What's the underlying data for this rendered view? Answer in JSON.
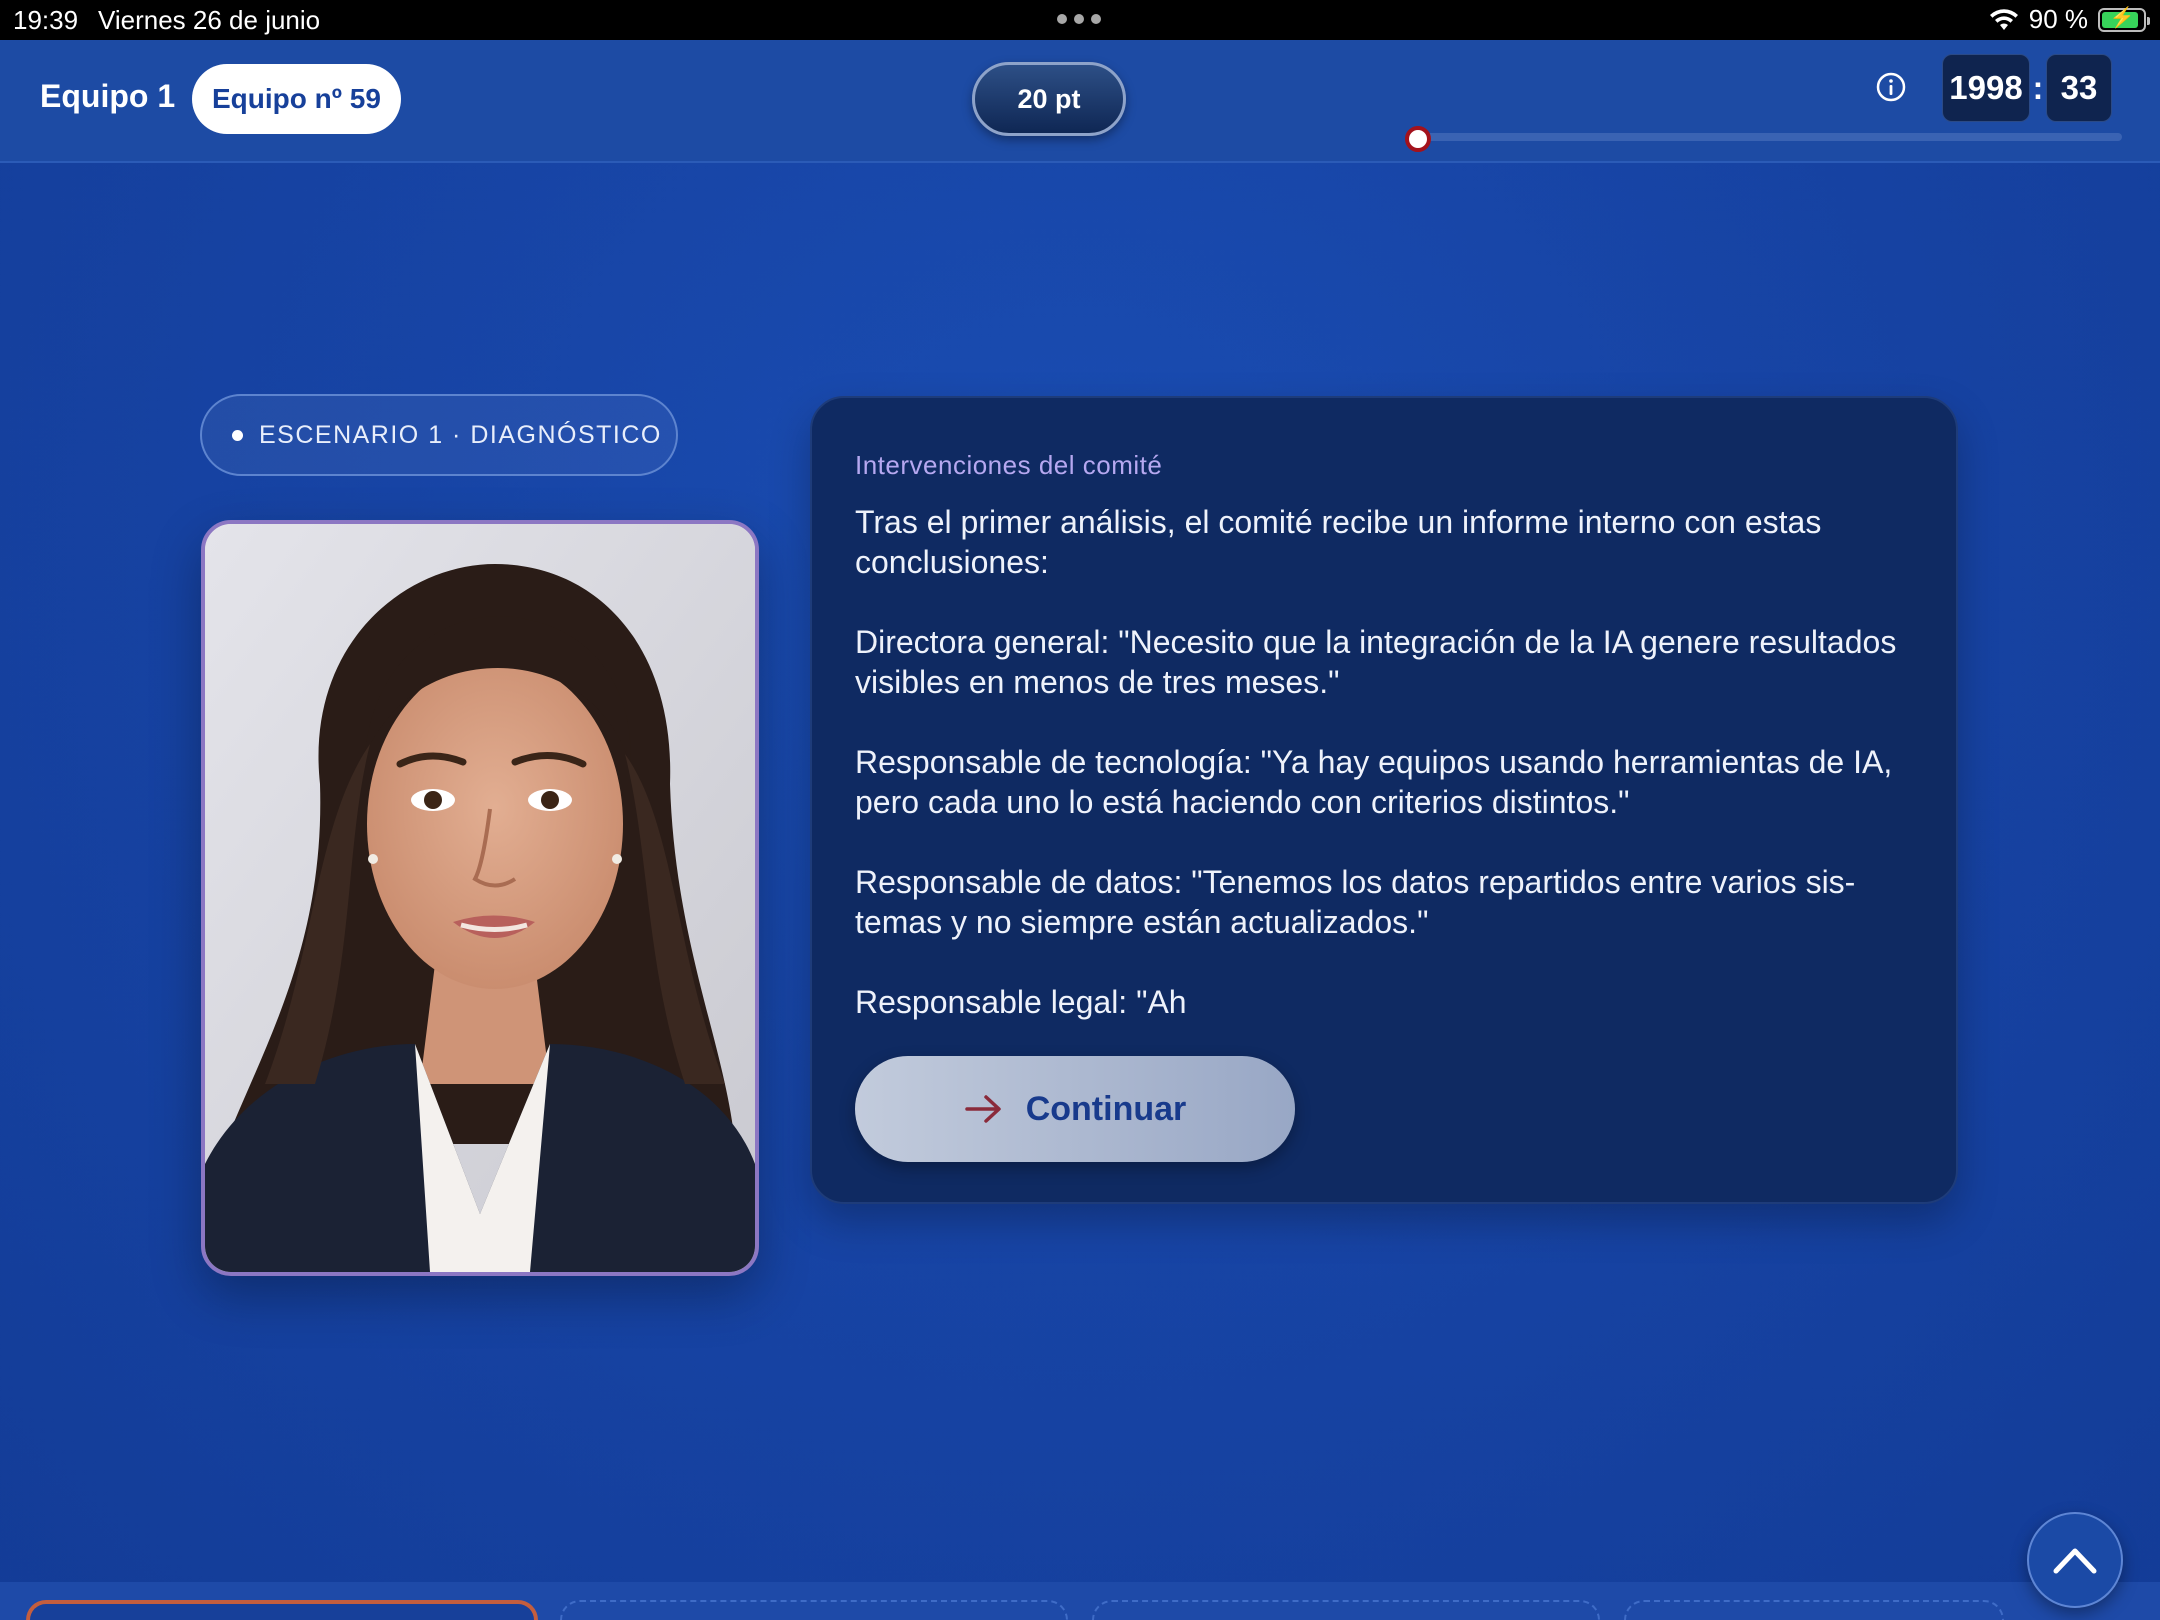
{
  "status_bar": {
    "time": "19:39",
    "date": "Viernes 26 de junio",
    "battery": "90 %",
    "battery_level": 0.9
  },
  "header": {
    "team_label": "Equipo 1",
    "team_chip": "Equipo nº 59",
    "points": "20 pt",
    "timer": {
      "minutes": "1998",
      "separator": ":",
      "seconds": "33"
    },
    "progress": 0.0,
    "icons": {
      "info": "info-icon"
    },
    "colors": {
      "bar": "#1d4ba4",
      "knob_ring": "#a3121c"
    }
  },
  "scenario": {
    "label": "ESCENARIO 1 · DIAGNÓSTICO"
  },
  "card": {
    "kicker": "Intervenciones del comité",
    "paragraphs": [
      "Tras el primer análisis, el comité recibe un informe interno con estas conclusiones:",
      "Directora general: \"Necesito que la integración de la IA genere resul­tados visibles en menos de tres meses.\"",
      "Responsable de tecnología: \"Ya hay equipos usando herramientas de IA, pero cada uno lo está haciendo con criterios distintos.\"",
      "Responsable de datos: \"Tenemos los datos repartidos entre varios sis­temas y no siempre están actualizados.\"",
      "Responsable legal: \"Ah"
    ],
    "continue_label": "Continuar",
    "colors": {
      "card_bg": "#0f2a62",
      "kicker": "#b6a8f0",
      "button_text": "#183a8c",
      "arrow": "#8a2a3a"
    }
  },
  "colors": {
    "background": "#1744a5"
  }
}
